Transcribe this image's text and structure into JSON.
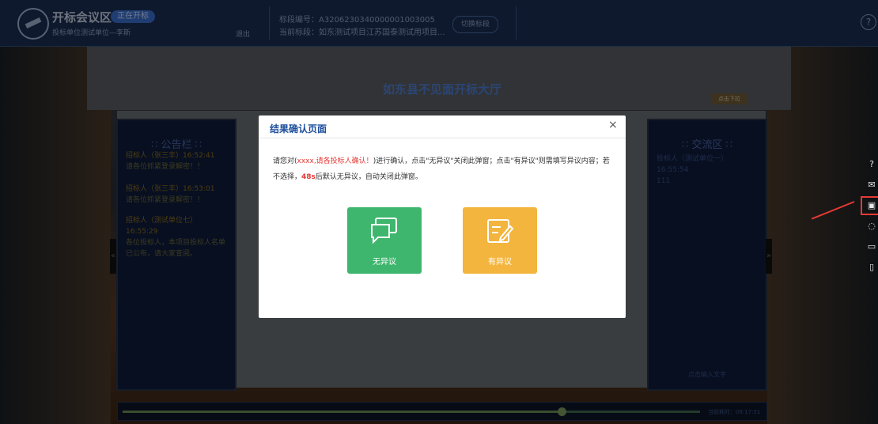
{
  "header": {
    "app_title": "开标会议区",
    "badge": "正在开标",
    "user": "投标单位测试单位—李斯",
    "logout": "退出",
    "section_no": "标段编号：A3206230340000001003005",
    "current_section": "当前标段：如东测试项目江苏国泰测试用项目...",
    "switch_label": "切换标段",
    "help": "?"
  },
  "hall": {
    "title": "如东县不见面开标大厅",
    "click_next": "点击下拉"
  },
  "notice_board": {
    "title": "∷ 公告栏 ∷",
    "items": [
      {
        "by": "招标人（张三丰）16:52:41",
        "msg": "请各位抓紧登录解密！！"
      },
      {
        "by": "招标人（张三丰）16:53:01",
        "msg": "请各位抓紧登录解密！！"
      },
      {
        "by": "招标人（测试单位七）16:55:29",
        "msg": "各位投标人，本项目投标人名单已公布，请大家查阅。"
      }
    ]
  },
  "chat_board": {
    "title": "∷ 交流区 ∷",
    "line1": "投标人（测试单位一）16:55:54",
    "line2": "111",
    "input_hint": "点击输入文字"
  },
  "progress": {
    "time": "当前耗时：08:17:51",
    "value": 0.76
  },
  "modal": {
    "title": "结果确认页面",
    "close": "×",
    "text_before": "请您对(",
    "text_red": "xxxx,请各投标人确认！",
    "text_after": ")进行确认，点击\"无异议\"关闭此弹窗；点击\"有异议\"则需填写异议内容；若不选择，",
    "countdown": "48s",
    "text_end": "后默认无异议，自动关闭此弹窗。",
    "no_objection": "无异议",
    "objection": "有异议"
  },
  "toolbar": {
    "icons": [
      "help-icon",
      "mail-icon",
      "document-icon",
      "chat-icon",
      "comment-icon",
      "book-icon"
    ]
  },
  "colors": {
    "accent": "#3fb66e",
    "warn": "#f3b53d",
    "highlight": "#e53935"
  }
}
